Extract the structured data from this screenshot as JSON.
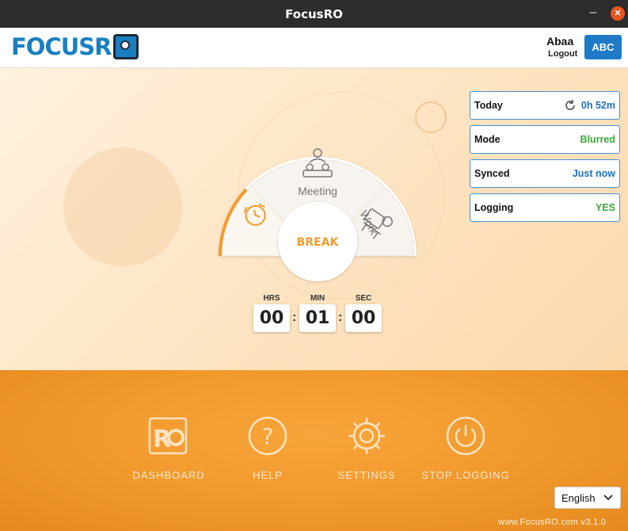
{
  "window": {
    "title": "FocusRO"
  },
  "header": {
    "logo_text": "FOCUSR",
    "user_name": "Abaa",
    "logout_label": "Logout",
    "avatar_label": "ABC"
  },
  "status": [
    {
      "label": "Today",
      "value": "0h 52m",
      "icon": "refresh-icon",
      "color": "#1f6fc0"
    },
    {
      "label": "Mode",
      "value": "Blurred",
      "color": "#3aa83a"
    },
    {
      "label": "Synced",
      "value": "Just now",
      "color": "#1f6fc0"
    },
    {
      "label": "Logging",
      "value": "YES",
      "color": "#3aa83a"
    }
  ],
  "dial": {
    "segments": [
      {
        "icon": "clock-icon"
      },
      {
        "label": "Meeting",
        "icon": "meeting-icon"
      },
      {
        "label": "Work",
        "icon": "work-desk-icon"
      }
    ],
    "center_label": "BREAK",
    "accent": "#f39a2c"
  },
  "timer": {
    "hours_label": "HRS",
    "hours": "00",
    "minutes_label": "MIN",
    "minutes": "01",
    "seconds_label": "SEC",
    "seconds": "00",
    "separator": ":"
  },
  "nav": [
    {
      "label": "DASHBOARD",
      "icon": "dashboard-ro-icon"
    },
    {
      "label": "HELP",
      "icon": "help-question-icon"
    },
    {
      "label": "SETTINGS",
      "icon": "gear-icon"
    },
    {
      "label": "STOP LOGGING",
      "icon": "power-icon"
    }
  ],
  "language": {
    "selected": "English"
  },
  "footer": {
    "text": "www.FocusRO.com v3.1.0"
  }
}
